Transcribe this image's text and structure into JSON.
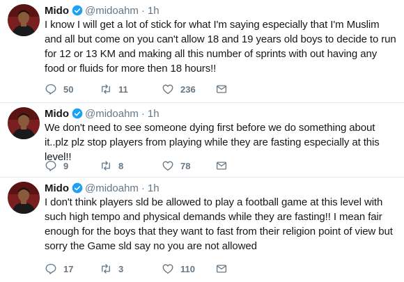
{
  "tweets": [
    {
      "name": "Mido",
      "handle": "@midoahm",
      "separator": "·",
      "time": "1h",
      "text": "I know I will get a lot of stick for what I'm saying especially that I'm Muslim and all but come on you can't allow 18 and 19 years old boys to decide to run for 12 or 13 KM and making all this number of sprints with out having any food or fluids for more then 18 hours!!",
      "replies": "50",
      "retweets": "11",
      "likes": "236"
    },
    {
      "name": "Mido",
      "handle": "@midoahm",
      "separator": "·",
      "time": "1h",
      "text": "We don't need to see someone dying first before we do something about it..plz plz stop players from playing while they are fasting especially at this level!!",
      "replies": "9",
      "retweets": "8",
      "likes": "78"
    },
    {
      "name": "Mido",
      "handle": "@midoahm",
      "separator": "·",
      "time": "1h",
      "text": "I don't think players sld be allowed to play a football game at this level with such high tempo and physical demands while they are fasting!! I mean fair enough for the boys that they want to fast from their religion point of view but sorry the Game sld say no you are not allowed",
      "replies": "17",
      "retweets": "3",
      "likes": "110"
    }
  ],
  "icons": {
    "reply": "reply-icon",
    "retweet": "retweet-icon",
    "like": "heart-icon",
    "message": "envelope-icon",
    "verified": "verified-badge-icon"
  },
  "colors": {
    "verified": "#1da1f2",
    "muted": "#657786",
    "text": "#14171a",
    "divider": "#e6ecf0"
  }
}
